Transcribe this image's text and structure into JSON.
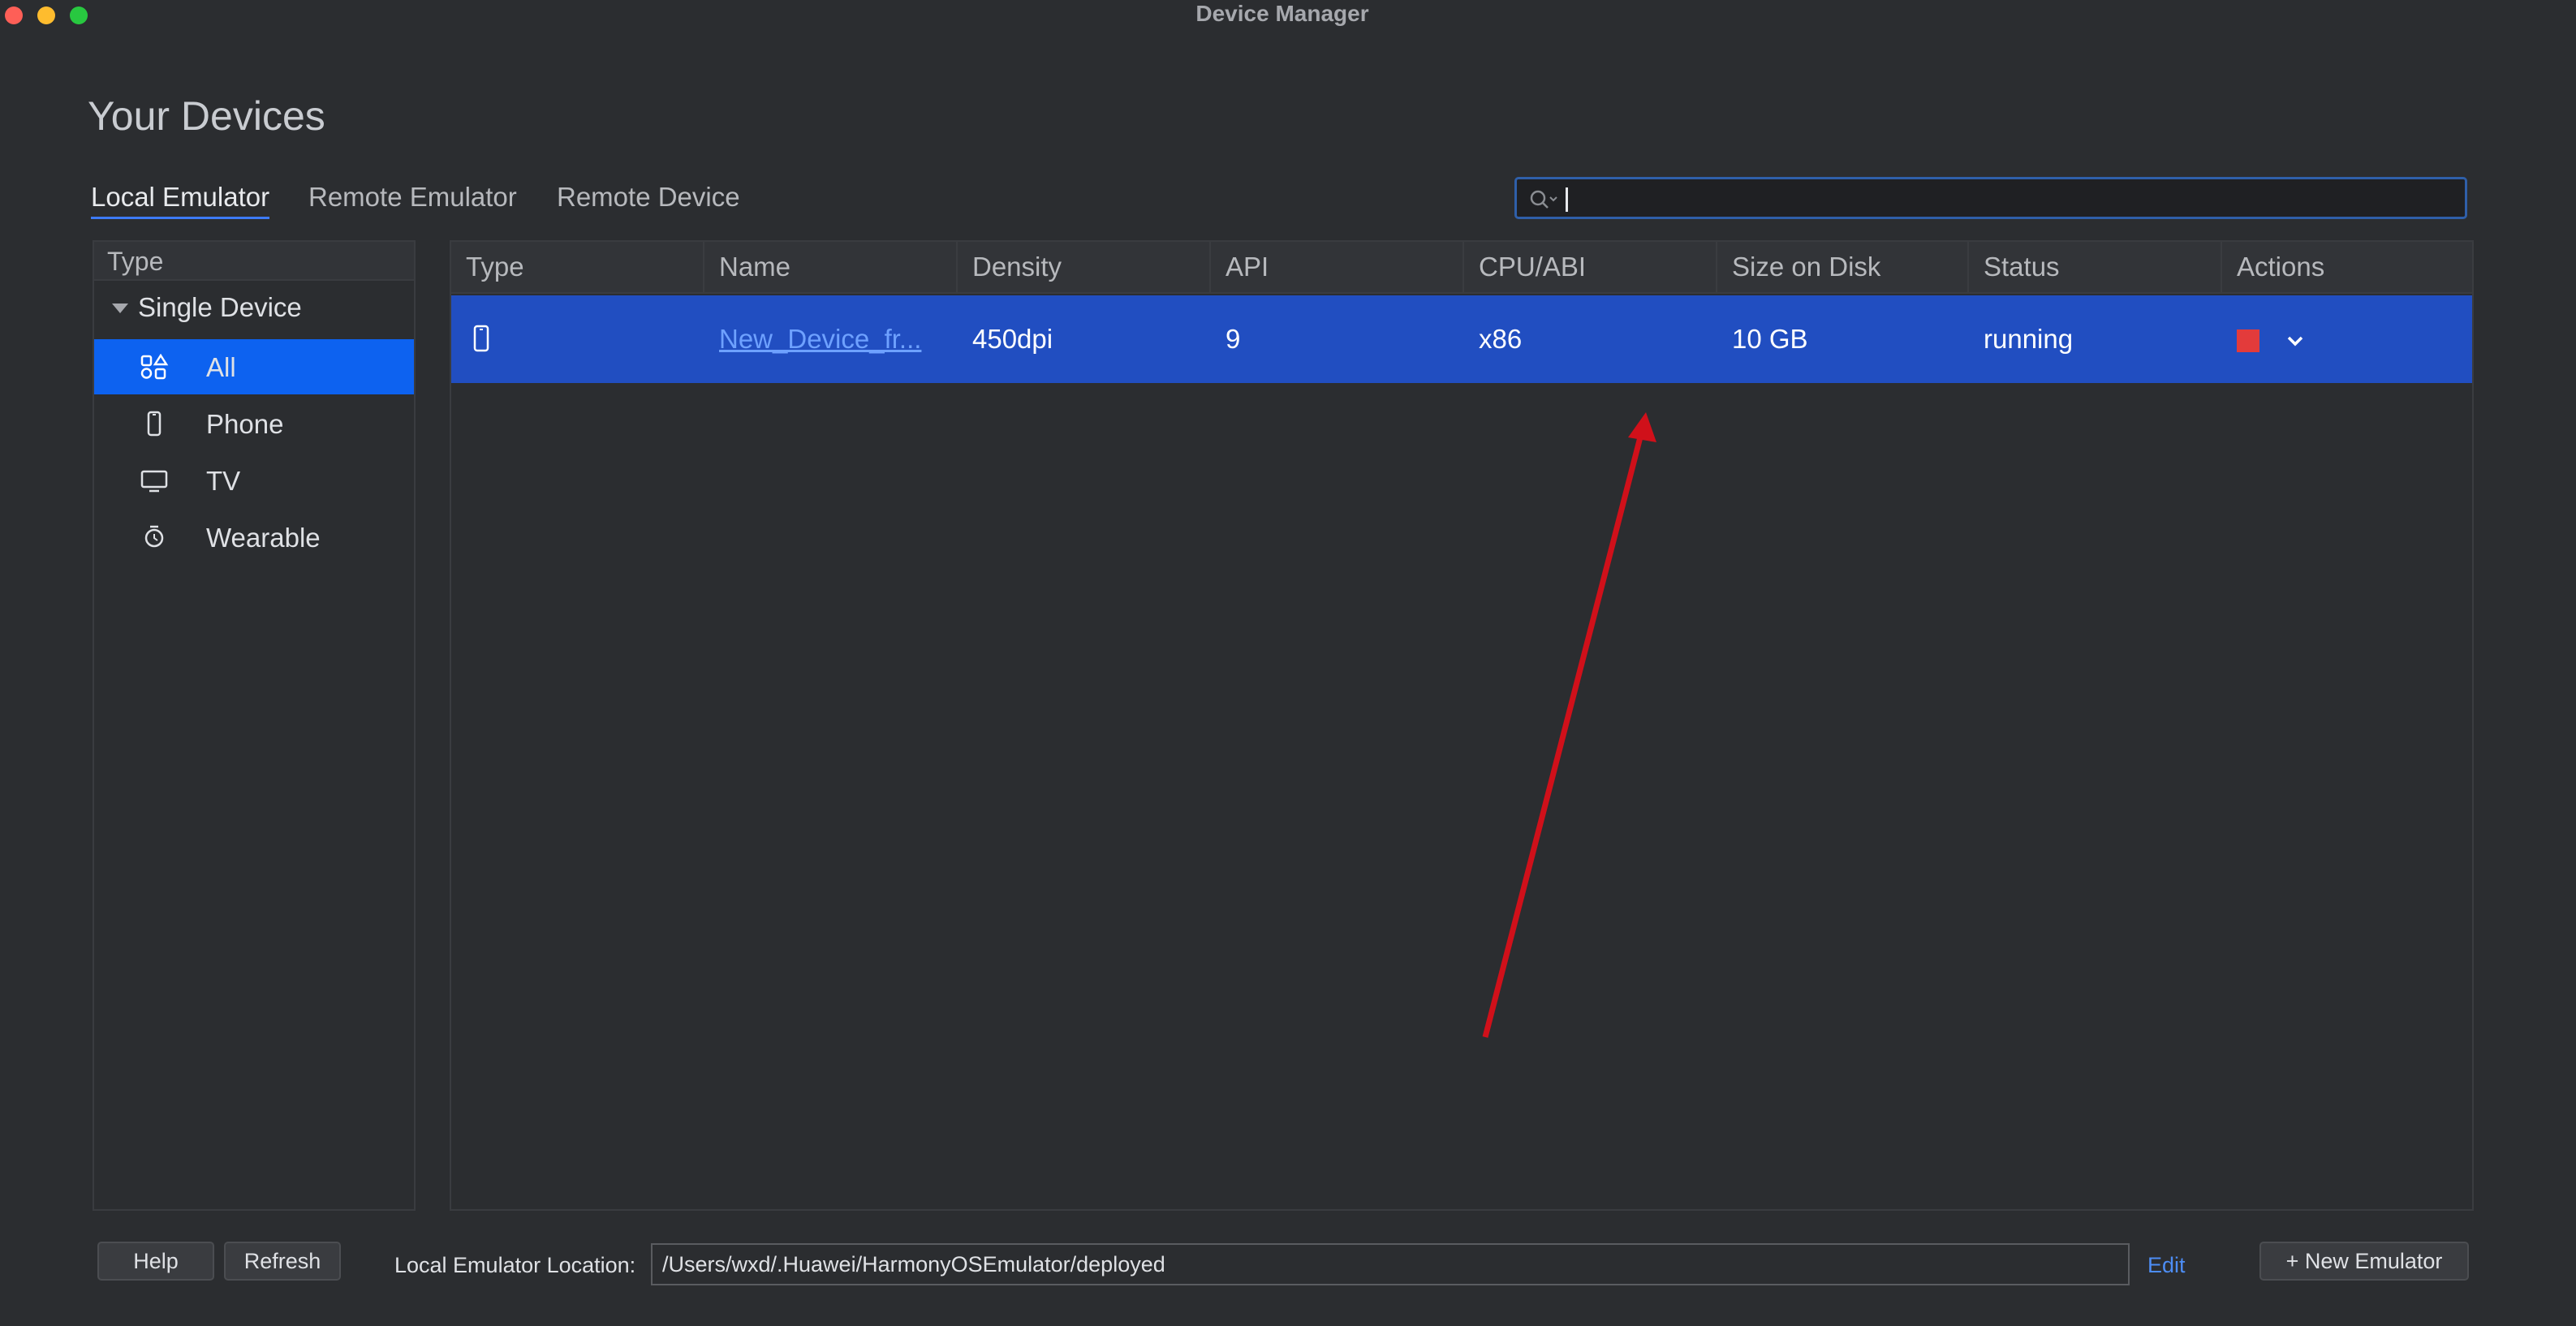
{
  "window": {
    "title": "Device Manager"
  },
  "page": {
    "title": "Your Devices"
  },
  "tabs": [
    "Local Emulator",
    "Remote Emulator",
    "Remote Device"
  ],
  "search": {
    "value": "",
    "placeholder": ""
  },
  "sidebar": {
    "header": "Type",
    "group": "Single Device",
    "items": [
      {
        "label": "All",
        "icon": "all-devices-icon"
      },
      {
        "label": "Phone",
        "icon": "phone-icon"
      },
      {
        "label": "TV",
        "icon": "tv-icon"
      },
      {
        "label": "Wearable",
        "icon": "watch-icon"
      }
    ]
  },
  "table": {
    "columns": [
      "Type",
      "Name",
      "Density",
      "API",
      "CPU/ABI",
      "Size on Disk",
      "Status",
      "Actions"
    ],
    "rows": [
      {
        "type_icon": "phone-icon",
        "name": "New_Device_fr...",
        "density": "450dpi",
        "api": "9",
        "cpu": "x86",
        "size": "10 GB",
        "status": "running"
      }
    ]
  },
  "footer": {
    "help": "Help",
    "refresh": "Refresh",
    "location_label": "Local Emulator Location:",
    "location_value": "/Users/wxd/.Huawei/HarmonyOSEmulator/deployed",
    "edit": "Edit",
    "new_emulator": "+ New Emulator"
  },
  "colors": {
    "background": "#2b2d30",
    "selection": "#0d62f0",
    "row_selected": "#214ec1",
    "stop": "#e33b3b",
    "annotation_arrow": "#d0101a"
  }
}
